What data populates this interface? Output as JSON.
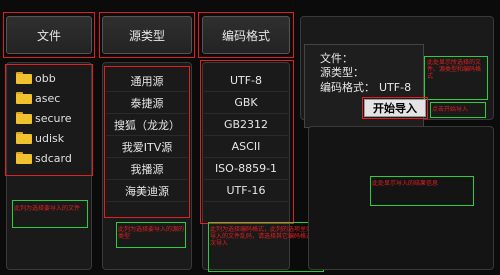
{
  "headers": {
    "file": "文件",
    "source_type": "源类型",
    "encoding": "编码格式"
  },
  "files": [
    "obb",
    "asec",
    "secure",
    "udisk",
    "sdcard"
  ],
  "sources": [
    "通用源",
    "泰捷源",
    "搜狐（龙龙）",
    "我爱ITV源",
    "我播源",
    "海美迪源"
  ],
  "encodings": [
    "UTF-8",
    "GBK",
    "GB2312",
    "ASCII",
    "ISO-8859-1",
    "UTF-16"
  ],
  "info": {
    "file_label": "文件：",
    "source_label": "源类型：",
    "encoding_label": "编码格式：",
    "encoding_value": "UTF-8"
  },
  "start_button": "开始导入",
  "notes": {
    "file_note": "此列为选择要导入的文件",
    "source_note": "此列为选择要导入的源的类型",
    "encoding_note": "此列为选择编码格式，此列的选项里如要导入的文件乱码，请选择其它编码格式再次导入",
    "info_note": "此处显示所选择的文件、源类型和编码格式",
    "button_note": "点击开始导入",
    "log_note": "此处显示导入的结果信息"
  }
}
